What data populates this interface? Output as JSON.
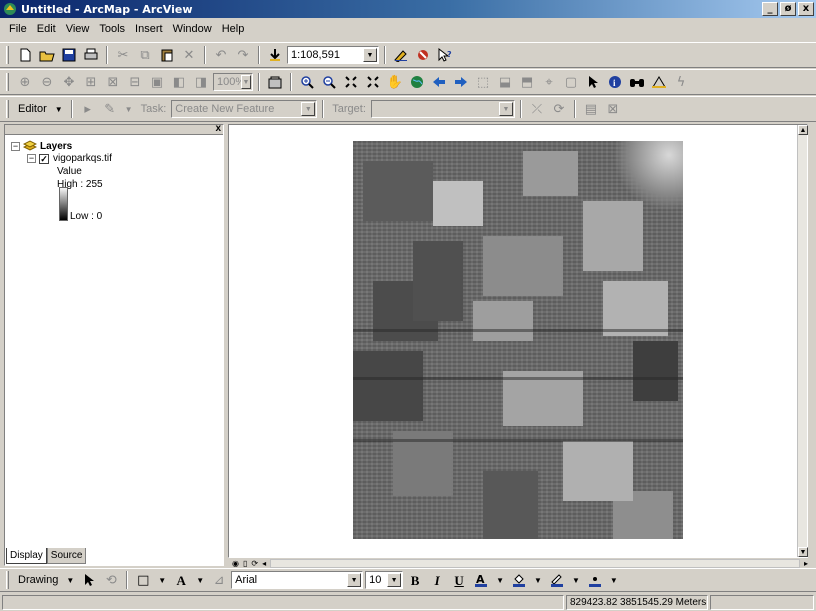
{
  "window": {
    "title": "Untitled - ArcMap - ArcView",
    "minimize": "_",
    "maximize": "ø",
    "close": "x"
  },
  "menu": {
    "items": [
      "File",
      "Edit",
      "View",
      "Tools",
      "Insert",
      "Window",
      "Help"
    ]
  },
  "standard_toolbar": {
    "scale_value": "1:108,591"
  },
  "tools_toolbar": {
    "zoom_percent": "100%"
  },
  "editor_toolbar": {
    "editor_label": "Editor",
    "task_label": "Task:",
    "task_value": "Create New Feature",
    "target_label": "Target:",
    "target_value": ""
  },
  "toc": {
    "root_label": "Layers",
    "layer_name": "vigoparkqs.tif",
    "legend_heading": "Value",
    "high_label": "High : 255",
    "low_label": "Low : 0",
    "tabs": [
      "Display",
      "Source"
    ]
  },
  "drawing_toolbar": {
    "drawing_label": "Drawing",
    "font_name": "Arial",
    "font_size": "10",
    "bold": "B",
    "italic": "I",
    "underline": "U"
  },
  "status": {
    "coordinates": "829423.82  3851545.29 Meters"
  },
  "colors": {
    "title_gradient_start": "#0a246a",
    "title_gradient_end": "#a6caf0",
    "chrome": "#d4d0c8"
  }
}
